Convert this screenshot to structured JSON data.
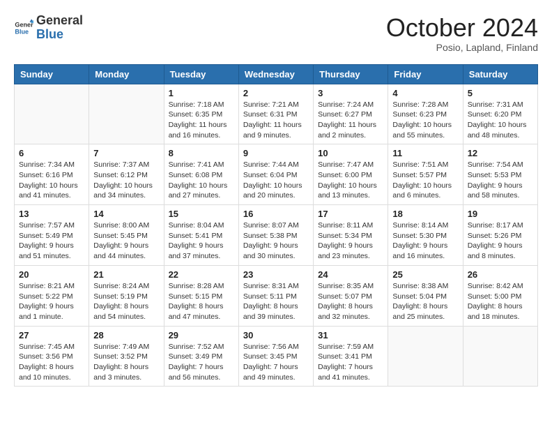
{
  "header": {
    "logo_general": "General",
    "logo_blue": "Blue",
    "month_title": "October 2024",
    "subtitle": "Posio, Lapland, Finland"
  },
  "days_of_week": [
    "Sunday",
    "Monday",
    "Tuesday",
    "Wednesday",
    "Thursday",
    "Friday",
    "Saturday"
  ],
  "weeks": [
    [
      {
        "day": "",
        "info": ""
      },
      {
        "day": "",
        "info": ""
      },
      {
        "day": "1",
        "info": "Sunrise: 7:18 AM\nSunset: 6:35 PM\nDaylight: 11 hours and 16 minutes."
      },
      {
        "day": "2",
        "info": "Sunrise: 7:21 AM\nSunset: 6:31 PM\nDaylight: 11 hours and 9 minutes."
      },
      {
        "day": "3",
        "info": "Sunrise: 7:24 AM\nSunset: 6:27 PM\nDaylight: 11 hours and 2 minutes."
      },
      {
        "day": "4",
        "info": "Sunrise: 7:28 AM\nSunset: 6:23 PM\nDaylight: 10 hours and 55 minutes."
      },
      {
        "day": "5",
        "info": "Sunrise: 7:31 AM\nSunset: 6:20 PM\nDaylight: 10 hours and 48 minutes."
      }
    ],
    [
      {
        "day": "6",
        "info": "Sunrise: 7:34 AM\nSunset: 6:16 PM\nDaylight: 10 hours and 41 minutes."
      },
      {
        "day": "7",
        "info": "Sunrise: 7:37 AM\nSunset: 6:12 PM\nDaylight: 10 hours and 34 minutes."
      },
      {
        "day": "8",
        "info": "Sunrise: 7:41 AM\nSunset: 6:08 PM\nDaylight: 10 hours and 27 minutes."
      },
      {
        "day": "9",
        "info": "Sunrise: 7:44 AM\nSunset: 6:04 PM\nDaylight: 10 hours and 20 minutes."
      },
      {
        "day": "10",
        "info": "Sunrise: 7:47 AM\nSunset: 6:00 PM\nDaylight: 10 hours and 13 minutes."
      },
      {
        "day": "11",
        "info": "Sunrise: 7:51 AM\nSunset: 5:57 PM\nDaylight: 10 hours and 6 minutes."
      },
      {
        "day": "12",
        "info": "Sunrise: 7:54 AM\nSunset: 5:53 PM\nDaylight: 9 hours and 58 minutes."
      }
    ],
    [
      {
        "day": "13",
        "info": "Sunrise: 7:57 AM\nSunset: 5:49 PM\nDaylight: 9 hours and 51 minutes."
      },
      {
        "day": "14",
        "info": "Sunrise: 8:00 AM\nSunset: 5:45 PM\nDaylight: 9 hours and 44 minutes."
      },
      {
        "day": "15",
        "info": "Sunrise: 8:04 AM\nSunset: 5:41 PM\nDaylight: 9 hours and 37 minutes."
      },
      {
        "day": "16",
        "info": "Sunrise: 8:07 AM\nSunset: 5:38 PM\nDaylight: 9 hours and 30 minutes."
      },
      {
        "day": "17",
        "info": "Sunrise: 8:11 AM\nSunset: 5:34 PM\nDaylight: 9 hours and 23 minutes."
      },
      {
        "day": "18",
        "info": "Sunrise: 8:14 AM\nSunset: 5:30 PM\nDaylight: 9 hours and 16 minutes."
      },
      {
        "day": "19",
        "info": "Sunrise: 8:17 AM\nSunset: 5:26 PM\nDaylight: 9 hours and 8 minutes."
      }
    ],
    [
      {
        "day": "20",
        "info": "Sunrise: 8:21 AM\nSunset: 5:22 PM\nDaylight: 9 hours and 1 minute."
      },
      {
        "day": "21",
        "info": "Sunrise: 8:24 AM\nSunset: 5:19 PM\nDaylight: 8 hours and 54 minutes."
      },
      {
        "day": "22",
        "info": "Sunrise: 8:28 AM\nSunset: 5:15 PM\nDaylight: 8 hours and 47 minutes."
      },
      {
        "day": "23",
        "info": "Sunrise: 8:31 AM\nSunset: 5:11 PM\nDaylight: 8 hours and 39 minutes."
      },
      {
        "day": "24",
        "info": "Sunrise: 8:35 AM\nSunset: 5:07 PM\nDaylight: 8 hours and 32 minutes."
      },
      {
        "day": "25",
        "info": "Sunrise: 8:38 AM\nSunset: 5:04 PM\nDaylight: 8 hours and 25 minutes."
      },
      {
        "day": "26",
        "info": "Sunrise: 8:42 AM\nSunset: 5:00 PM\nDaylight: 8 hours and 18 minutes."
      }
    ],
    [
      {
        "day": "27",
        "info": "Sunrise: 7:45 AM\nSunset: 3:56 PM\nDaylight: 8 hours and 10 minutes."
      },
      {
        "day": "28",
        "info": "Sunrise: 7:49 AM\nSunset: 3:52 PM\nDaylight: 8 hours and 3 minutes."
      },
      {
        "day": "29",
        "info": "Sunrise: 7:52 AM\nSunset: 3:49 PM\nDaylight: 7 hours and 56 minutes."
      },
      {
        "day": "30",
        "info": "Sunrise: 7:56 AM\nSunset: 3:45 PM\nDaylight: 7 hours and 49 minutes."
      },
      {
        "day": "31",
        "info": "Sunrise: 7:59 AM\nSunset: 3:41 PM\nDaylight: 7 hours and 41 minutes."
      },
      {
        "day": "",
        "info": ""
      },
      {
        "day": "",
        "info": ""
      }
    ]
  ]
}
